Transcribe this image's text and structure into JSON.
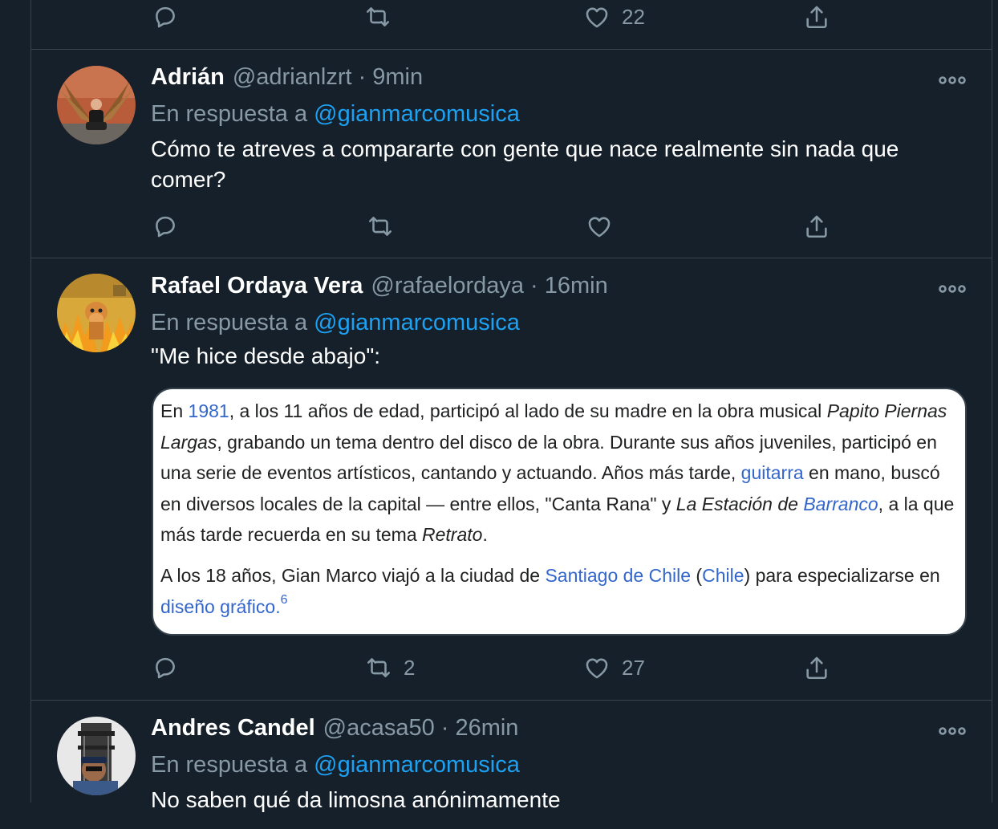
{
  "top_actions": {
    "like_count": "22"
  },
  "tweets": [
    {
      "name": "Adrián",
      "handle": "@adrianlzrt",
      "time": "9min",
      "reply_prefix": "En respuesta a ",
      "mention": "@gianmarcomusica",
      "text": "Cómo te atreves a compararte con gente que nace realmente sin nada que comer?",
      "retweet_count": "",
      "like_count": ""
    },
    {
      "name": "Rafael Ordaya Vera",
      "handle": "@rafaelordaya",
      "time": "16min",
      "reply_prefix": "En respuesta a ",
      "mention": "@gianmarcomusica",
      "text": "\"Me hice desde abajo\":",
      "retweet_count": "2",
      "like_count": "27",
      "card": {
        "p1": {
          "a": "En ",
          "b": "1981",
          "c": ", a los 11 años de edad, participó al lado de su madre en la obra musical ",
          "d": "Papito Piernas Largas",
          "e": ", grabando un tema dentro del disco de la obra. Durante sus años juveniles, participó en una serie de eventos artísticos, cantando y actuando. Años más tarde, ",
          "f": "guitarra",
          "g": " en mano, buscó en diversos locales de la capital — entre ellos, \"Canta Rana\" y ",
          "h": "La Estación de ",
          "i": "Barranco",
          "j": ", a la que más tarde recuerda en su tema ",
          "k": "Retrato",
          "l": "."
        },
        "p2": {
          "a": "A los 18 años, Gian Marco viajó a la ciudad de ",
          "b": "Santiago de Chile",
          "c": " (",
          "d": "Chile",
          "e": ") para especializarse en ",
          "f": "diseño gráfico",
          "g": ".",
          "sup": "6"
        }
      }
    },
    {
      "name": "Andres Candel",
      "handle": "@acasa50",
      "time": "26min",
      "reply_prefix": "En respuesta a ",
      "mention": "@gianmarcomusica",
      "text": "No saben qué da limosna anónimamente"
    }
  ],
  "separator": "·",
  "colors": {
    "background": "#15202b",
    "border": "#38444d",
    "muted": "#8899a6",
    "accent": "#1da1f2"
  }
}
